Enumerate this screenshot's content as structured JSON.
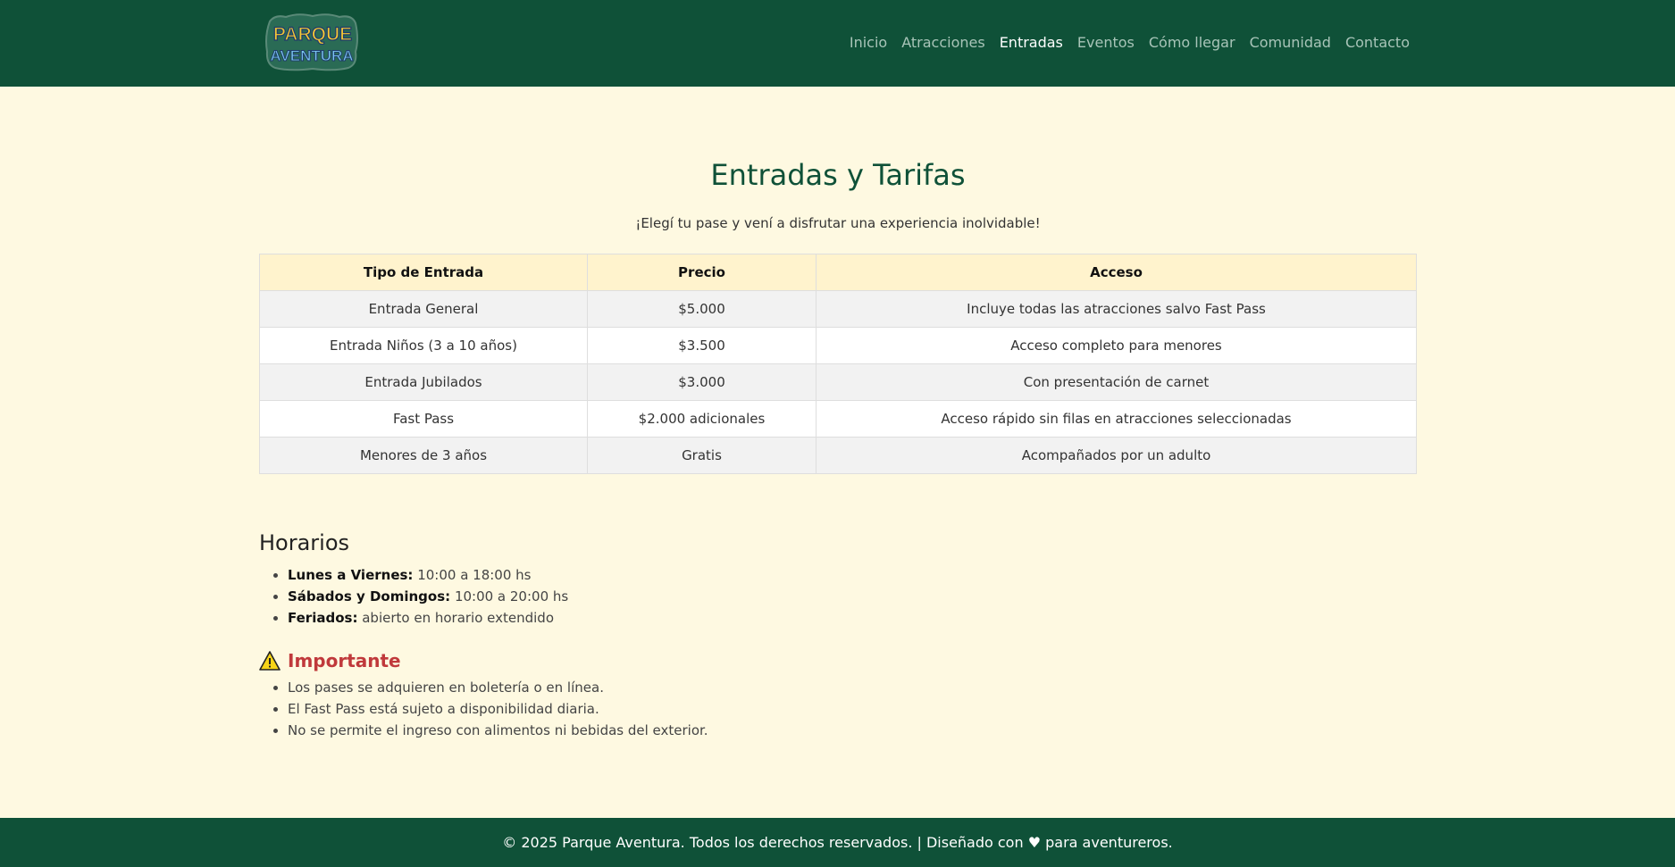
{
  "header": {
    "logo_line1": "PARQUE",
    "logo_line2": "AVENTURA",
    "nav": [
      {
        "label": "Inicio"
      },
      {
        "label": "Atracciones"
      },
      {
        "label": "Entradas"
      },
      {
        "label": "Eventos"
      },
      {
        "label": "Cómo llegar"
      },
      {
        "label": "Comunidad"
      },
      {
        "label": "Contacto"
      }
    ],
    "active_nav": "Entradas"
  },
  "main": {
    "title": "Entradas y Tarifas",
    "subtitle": "¡Elegí tu pase y vení a disfrutar una experiencia inolvidable!",
    "table": {
      "headers": [
        "Tipo de Entrada",
        "Precio",
        "Acceso"
      ],
      "rows": [
        [
          "Entrada General",
          "$5.000",
          "Incluye todas las atracciones salvo Fast Pass"
        ],
        [
          "Entrada Niños (3 a 10 años)",
          "$3.500",
          "Acceso completo para menores"
        ],
        [
          "Entrada Jubilados",
          "$3.000",
          "Con presentación de carnet"
        ],
        [
          "Fast Pass",
          "$2.000 adicionales",
          "Acceso rápido sin filas en atracciones seleccionadas"
        ],
        [
          "Menores de 3 años",
          "Gratis",
          "Acompañados por un adulto"
        ]
      ]
    },
    "horarios": {
      "title": "Horarios",
      "items": [
        {
          "label": "Lunes a Viernes:",
          "value": "10:00 a 18:00 hs"
        },
        {
          "label": "Sábados y Domingos:",
          "value": "10:00 a 20:00 hs"
        },
        {
          "label": "Feriados:",
          "value": "abierto en horario extendido"
        }
      ]
    },
    "importante": {
      "icon": "warning-icon",
      "title": "Importante",
      "items": [
        "Los pases se adquieren en boletería o en línea.",
        "El Fast Pass está sujeto a disponibilidad diaria.",
        "No se permite el ingreso con alimentos ni bebidas del exterior."
      ]
    }
  },
  "footer": {
    "text": "© 2025 Parque Aventura. Todos los derechos reservados. | Diseñado con ♥ para aventureros."
  },
  "colors": {
    "header_bg": "#0f5138",
    "page_bg": "#fef9e1",
    "title": "#0f5138",
    "table_header_bg": "#fff3cd",
    "important": "#c0393b"
  }
}
